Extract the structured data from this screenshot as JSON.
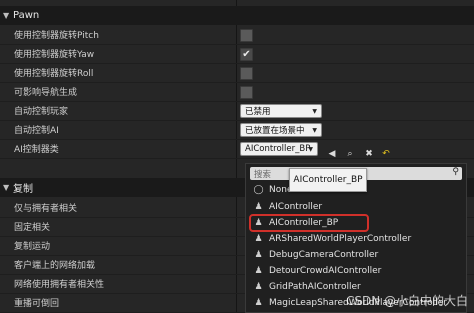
{
  "sections": {
    "pawn": {
      "title": "Pawn"
    },
    "replication": {
      "title": "复制"
    }
  },
  "pawn_rows": [
    {
      "label": "使用控制器旋转Pitch",
      "checked": false
    },
    {
      "label": "使用控制器旋转Yaw",
      "checked": true
    },
    {
      "label": "使用控制器旋转Roll",
      "checked": false
    },
    {
      "label": "可影响导航生成",
      "checked": false
    },
    {
      "label": "自动控制玩家",
      "value": "已禁用"
    },
    {
      "label": "自动控制AI",
      "value": "已放置在场景中"
    },
    {
      "label": "AI控制器类",
      "value": "AIController_BP"
    }
  ],
  "replication_rows": [
    {
      "label": "仅与拥有者相关"
    },
    {
      "label": "固定相关"
    },
    {
      "label": "复制运动"
    },
    {
      "label": "客户端上的网络加载"
    },
    {
      "label": "网络使用拥有者相关性"
    },
    {
      "label": "重播可倒回"
    }
  ],
  "dropdown": {
    "search_placeholder": "搜索",
    "options": [
      {
        "label": "None",
        "icon": "none-icon"
      },
      {
        "label": "AIController",
        "icon": "actor-icon"
      },
      {
        "label": "AIController_BP",
        "icon": "blueprint-icon",
        "selected": true
      },
      {
        "label": "ARSharedWorldPlayerController",
        "icon": "actor-icon"
      },
      {
        "label": "DebugCameraController",
        "icon": "actor-icon"
      },
      {
        "label": "DetourCrowdAIController",
        "icon": "actor-icon"
      },
      {
        "label": "GridPathAIController",
        "icon": "actor-icon"
      },
      {
        "label": "MagicLeapSharedWorldPlayerController",
        "icon": "actor-icon"
      }
    ]
  },
  "tooltip": "AIController_BP",
  "watermark": "CSDN @小白中的大白"
}
